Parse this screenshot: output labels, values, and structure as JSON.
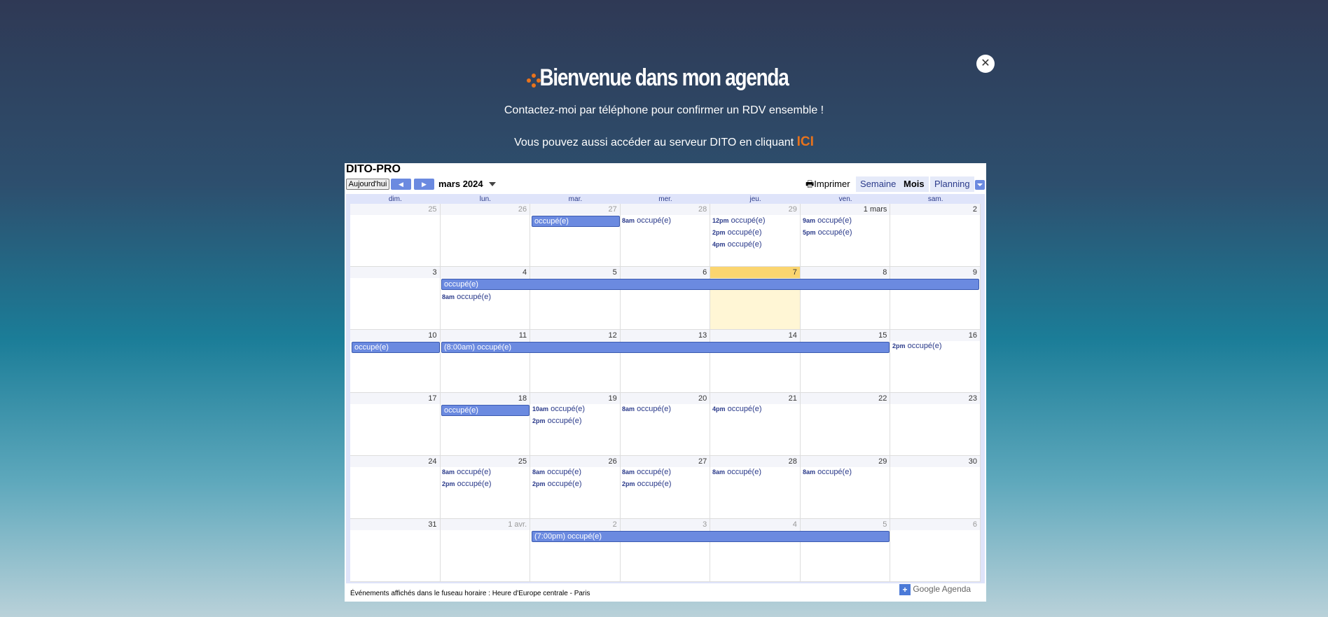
{
  "hero": {
    "title": "Bienvenue dans mon agenda",
    "line1": "Contactez-moi par téléphone pour confirmer un RDV ensemble !",
    "line2": "Vous pouvez aussi accéder au serveur DITO en cliquant",
    "link": "ICI",
    "close": "✕",
    "accent": "#e8731c"
  },
  "calendar": {
    "title": "DITO-PRO",
    "today_btn": "Aujourd'hui",
    "month": "mars 2024",
    "print": "Imprimer",
    "tabs": [
      "Semaine",
      "Mois",
      "Planning"
    ],
    "active_tab": "Mois",
    "weekdays": [
      "dim.",
      "lun.",
      "mar.",
      "mer.",
      "jeu.",
      "ven.",
      "sam."
    ],
    "weeks": [
      [
        "25",
        "26",
        "27",
        "28",
        "29",
        "1 mars",
        "2"
      ],
      [
        "3",
        "4",
        "5",
        "6",
        "7",
        "8",
        "9"
      ],
      [
        "10",
        "11",
        "12",
        "13",
        "14",
        "15",
        "16"
      ],
      [
        "17",
        "18",
        "19",
        "20",
        "21",
        "22",
        "23"
      ],
      [
        "24",
        "25",
        "26",
        "27",
        "28",
        "29",
        "30"
      ],
      [
        "31",
        "1 avr.",
        "2",
        "3",
        "4",
        "5",
        "6"
      ]
    ],
    "timezone_note": "Événements affichés dans le fuseau horaire : Heure d'Europe centrale - Paris",
    "brand": "Google Agenda",
    "event_color": "#6b8ae0",
    "today_color": "#fbd570",
    "events": [
      {
        "label": "occupé(e)",
        "time": ""
      },
      {
        "label": "occupé(e)",
        "time": "8am"
      },
      {
        "label": "occupé(e)",
        "time": "12pm"
      },
      {
        "label": "occupé(e)",
        "time": "2pm"
      },
      {
        "label": "occupé(e)",
        "time": "4pm"
      },
      {
        "label": "occupé(e)",
        "time": "9am"
      },
      {
        "label": "occupé(e)",
        "time": "5pm"
      },
      {
        "label": "(8:00am) occupé(e)",
        "time": ""
      },
      {
        "label": "(7:00pm) occupé(e)",
        "time": ""
      },
      {
        "label": "occupé(e)",
        "time": "10am"
      }
    ]
  }
}
